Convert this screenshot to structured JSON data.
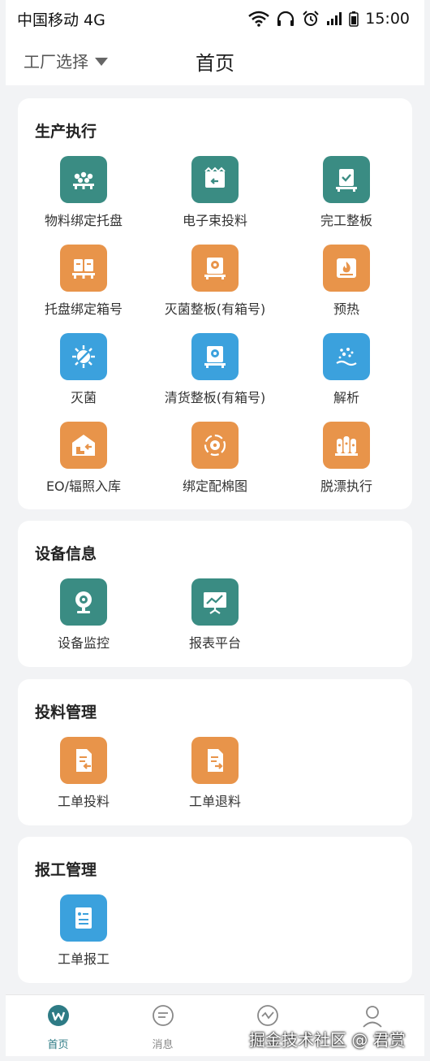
{
  "status_bar": {
    "carrier": "中国移动 4G",
    "time": "15:00"
  },
  "header": {
    "factory_select": "工厂选择",
    "title": "首页"
  },
  "sections": [
    {
      "title": "生产执行",
      "items": [
        {
          "label": "物料绑定托盘",
          "color": "teal",
          "icon": "material-pallet-icon"
        },
        {
          "label": "电子束投料",
          "color": "teal",
          "icon": "ebeam-feed-icon"
        },
        {
          "label": "完工整板",
          "color": "teal",
          "icon": "finished-board-icon"
        },
        {
          "label": "托盘绑定箱号",
          "color": "orange",
          "icon": "pallet-box-icon"
        },
        {
          "label": "灭菌整板(有箱号)",
          "color": "orange",
          "icon": "sterilize-board-icon"
        },
        {
          "label": "预热",
          "color": "orange",
          "icon": "preheat-icon"
        },
        {
          "label": "灭菌",
          "color": "blue",
          "icon": "sterilize-icon"
        },
        {
          "label": "清货整板(有箱号)",
          "color": "blue",
          "icon": "clear-board-icon"
        },
        {
          "label": "解析",
          "color": "blue",
          "icon": "analysis-icon"
        },
        {
          "label": "EO/辐照入库",
          "color": "orange",
          "icon": "warehouse-in-icon"
        },
        {
          "label": "绑定配棉图",
          "color": "orange",
          "icon": "cotton-map-icon"
        },
        {
          "label": "脱漂执行",
          "color": "orange",
          "icon": "bleach-icon"
        }
      ]
    },
    {
      "title": "设备信息",
      "items": [
        {
          "label": "设备监控",
          "color": "teal",
          "icon": "camera-icon"
        },
        {
          "label": "报表平台",
          "color": "teal",
          "icon": "report-icon"
        }
      ]
    },
    {
      "title": "投料管理",
      "items": [
        {
          "label": "工单投料",
          "color": "orange",
          "icon": "order-feed-icon"
        },
        {
          "label": "工单退料",
          "color": "orange",
          "icon": "order-return-icon"
        }
      ]
    },
    {
      "title": "报工管理",
      "items": [
        {
          "label": "工单报工",
          "color": "blue",
          "icon": "order-report-icon"
        }
      ]
    }
  ],
  "tabbar": [
    {
      "label": "首页",
      "icon": "home-icon",
      "active": true
    },
    {
      "label": "消息",
      "icon": "message-icon",
      "active": false
    },
    {
      "label": "",
      "icon": "monitor-icon",
      "active": false
    },
    {
      "label": "",
      "icon": "user-icon",
      "active": false
    }
  ],
  "watermark": "掘金技术社区 @ 君赏",
  "colors": {
    "teal": "#3a8c83",
    "orange": "#e8944a",
    "blue": "#3ba1dd",
    "active_tab": "#2e7b85"
  }
}
